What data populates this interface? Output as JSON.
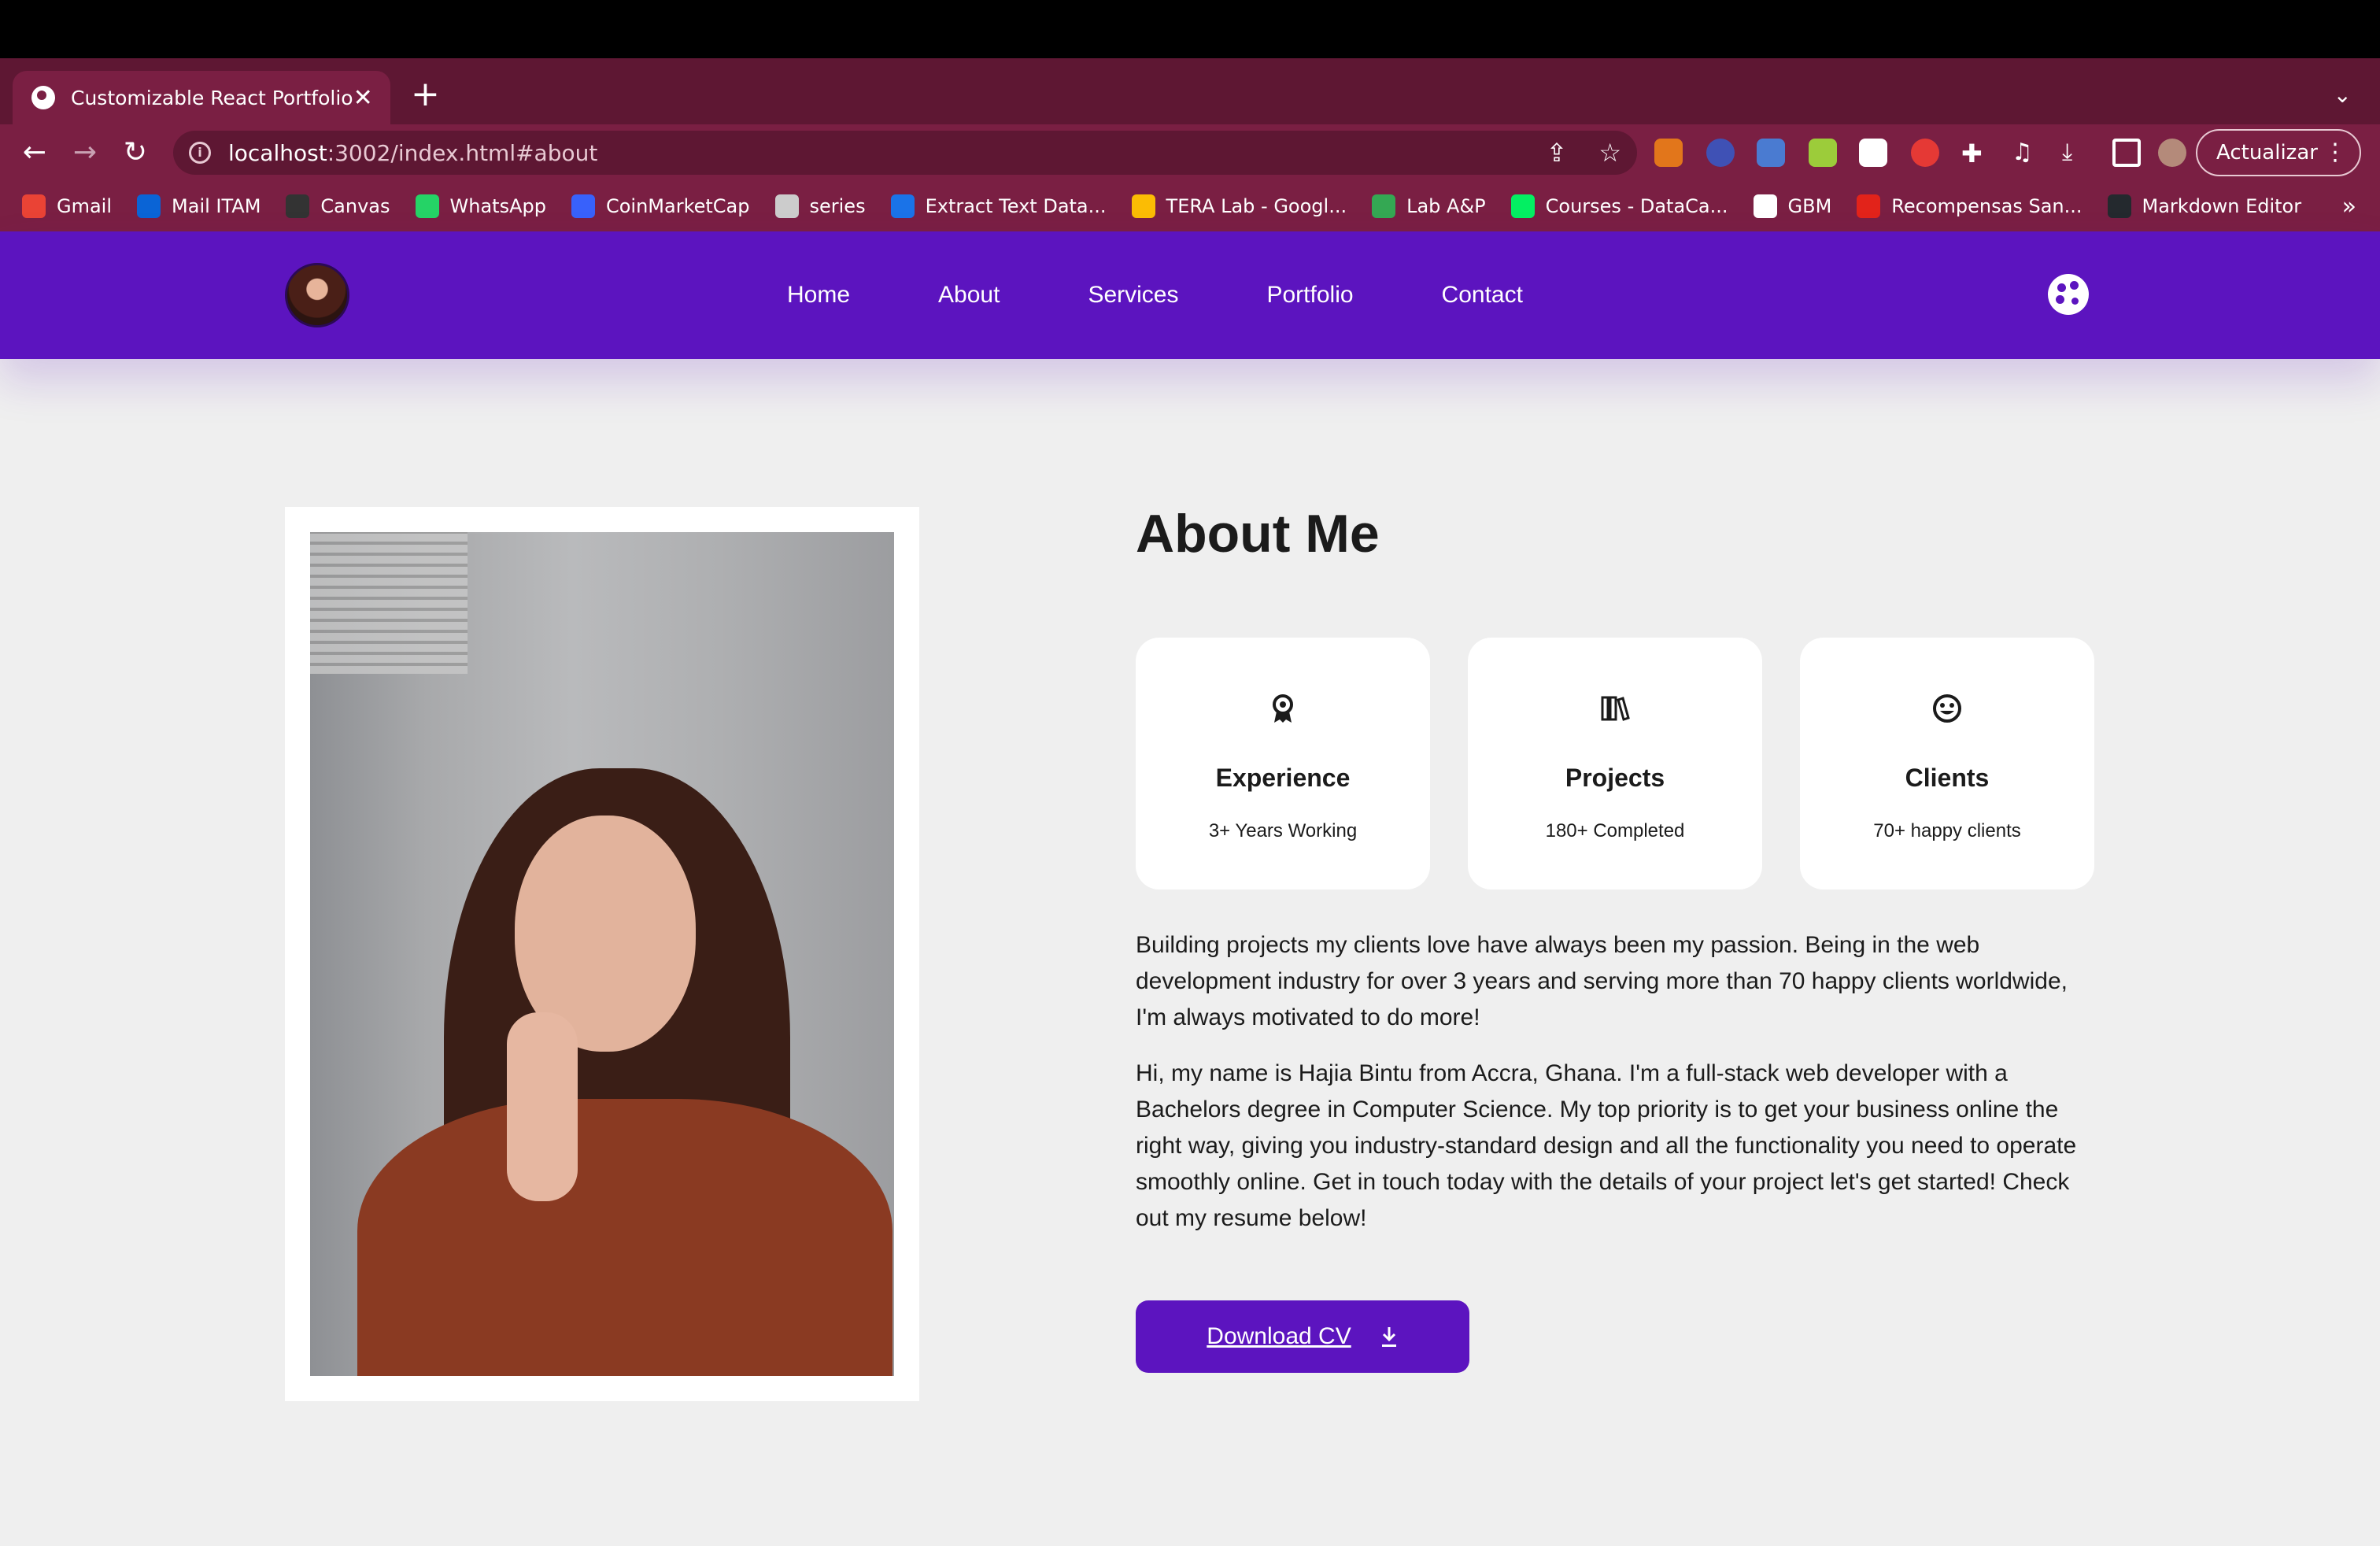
{
  "browser": {
    "tab_title": "Customizable React Portfolio",
    "tab_close": "✕",
    "new_tab": "+",
    "tab_menu": "⌄",
    "url_host": "localhost",
    "url_path": ":3002/index.html#about",
    "update_label": "Actualizar",
    "bookmarks": [
      {
        "label": "Gmail",
        "color": "#ea4335"
      },
      {
        "label": "Mail ITAM",
        "color": "#0a64d6"
      },
      {
        "label": "Canvas",
        "color": "#333333"
      },
      {
        "label": "WhatsApp",
        "color": "#25d366"
      },
      {
        "label": "CoinMarketCap",
        "color": "#3861fb"
      },
      {
        "label": "series",
        "color": "#cccccc"
      },
      {
        "label": "Extract Text Data...",
        "color": "#1a73e8"
      },
      {
        "label": "TERA Lab - Googl...",
        "color": "#fbbc04"
      },
      {
        "label": "Lab A&P",
        "color": "#34a853"
      },
      {
        "label": "Courses - DataCa...",
        "color": "#03ef62"
      },
      {
        "label": "GBM",
        "color": "#ffffff"
      },
      {
        "label": "Recompensas San...",
        "color": "#e2231a"
      },
      {
        "label": "Markdown Editor",
        "color": "#24292e"
      }
    ],
    "bookmarks_more": "»"
  },
  "site": {
    "nav": [
      "Home",
      "About",
      "Services",
      "Portfolio",
      "Contact"
    ],
    "accent": "#5c14bf"
  },
  "about": {
    "title": "About Me",
    "cards": [
      {
        "title": "Experience",
        "subtitle": "3+ Years Working",
        "icon": "award-icon"
      },
      {
        "title": "Projects",
        "subtitle": "180+ Completed",
        "icon": "books-icon"
      },
      {
        "title": "Clients",
        "subtitle": "70+ happy clients",
        "icon": "smile-icon"
      }
    ],
    "paragraph1": "Building projects my clients love have always been my passion. Being in the web development industry for over 3 years and serving more than 70 happy clients worldwide, I'm always motivated to do more!",
    "paragraph2": "Hi, my name is Hajia Bintu from Accra, Ghana. I'm a full-stack web developer with a Bachelors degree in Computer Science. My top priority is to get your business online the right way, giving you industry-standard design and all the functionality you need to operate smoothly online. Get in touch today with the details of your project let's get started! Check out my resume below!",
    "cv_label": "Download CV"
  }
}
